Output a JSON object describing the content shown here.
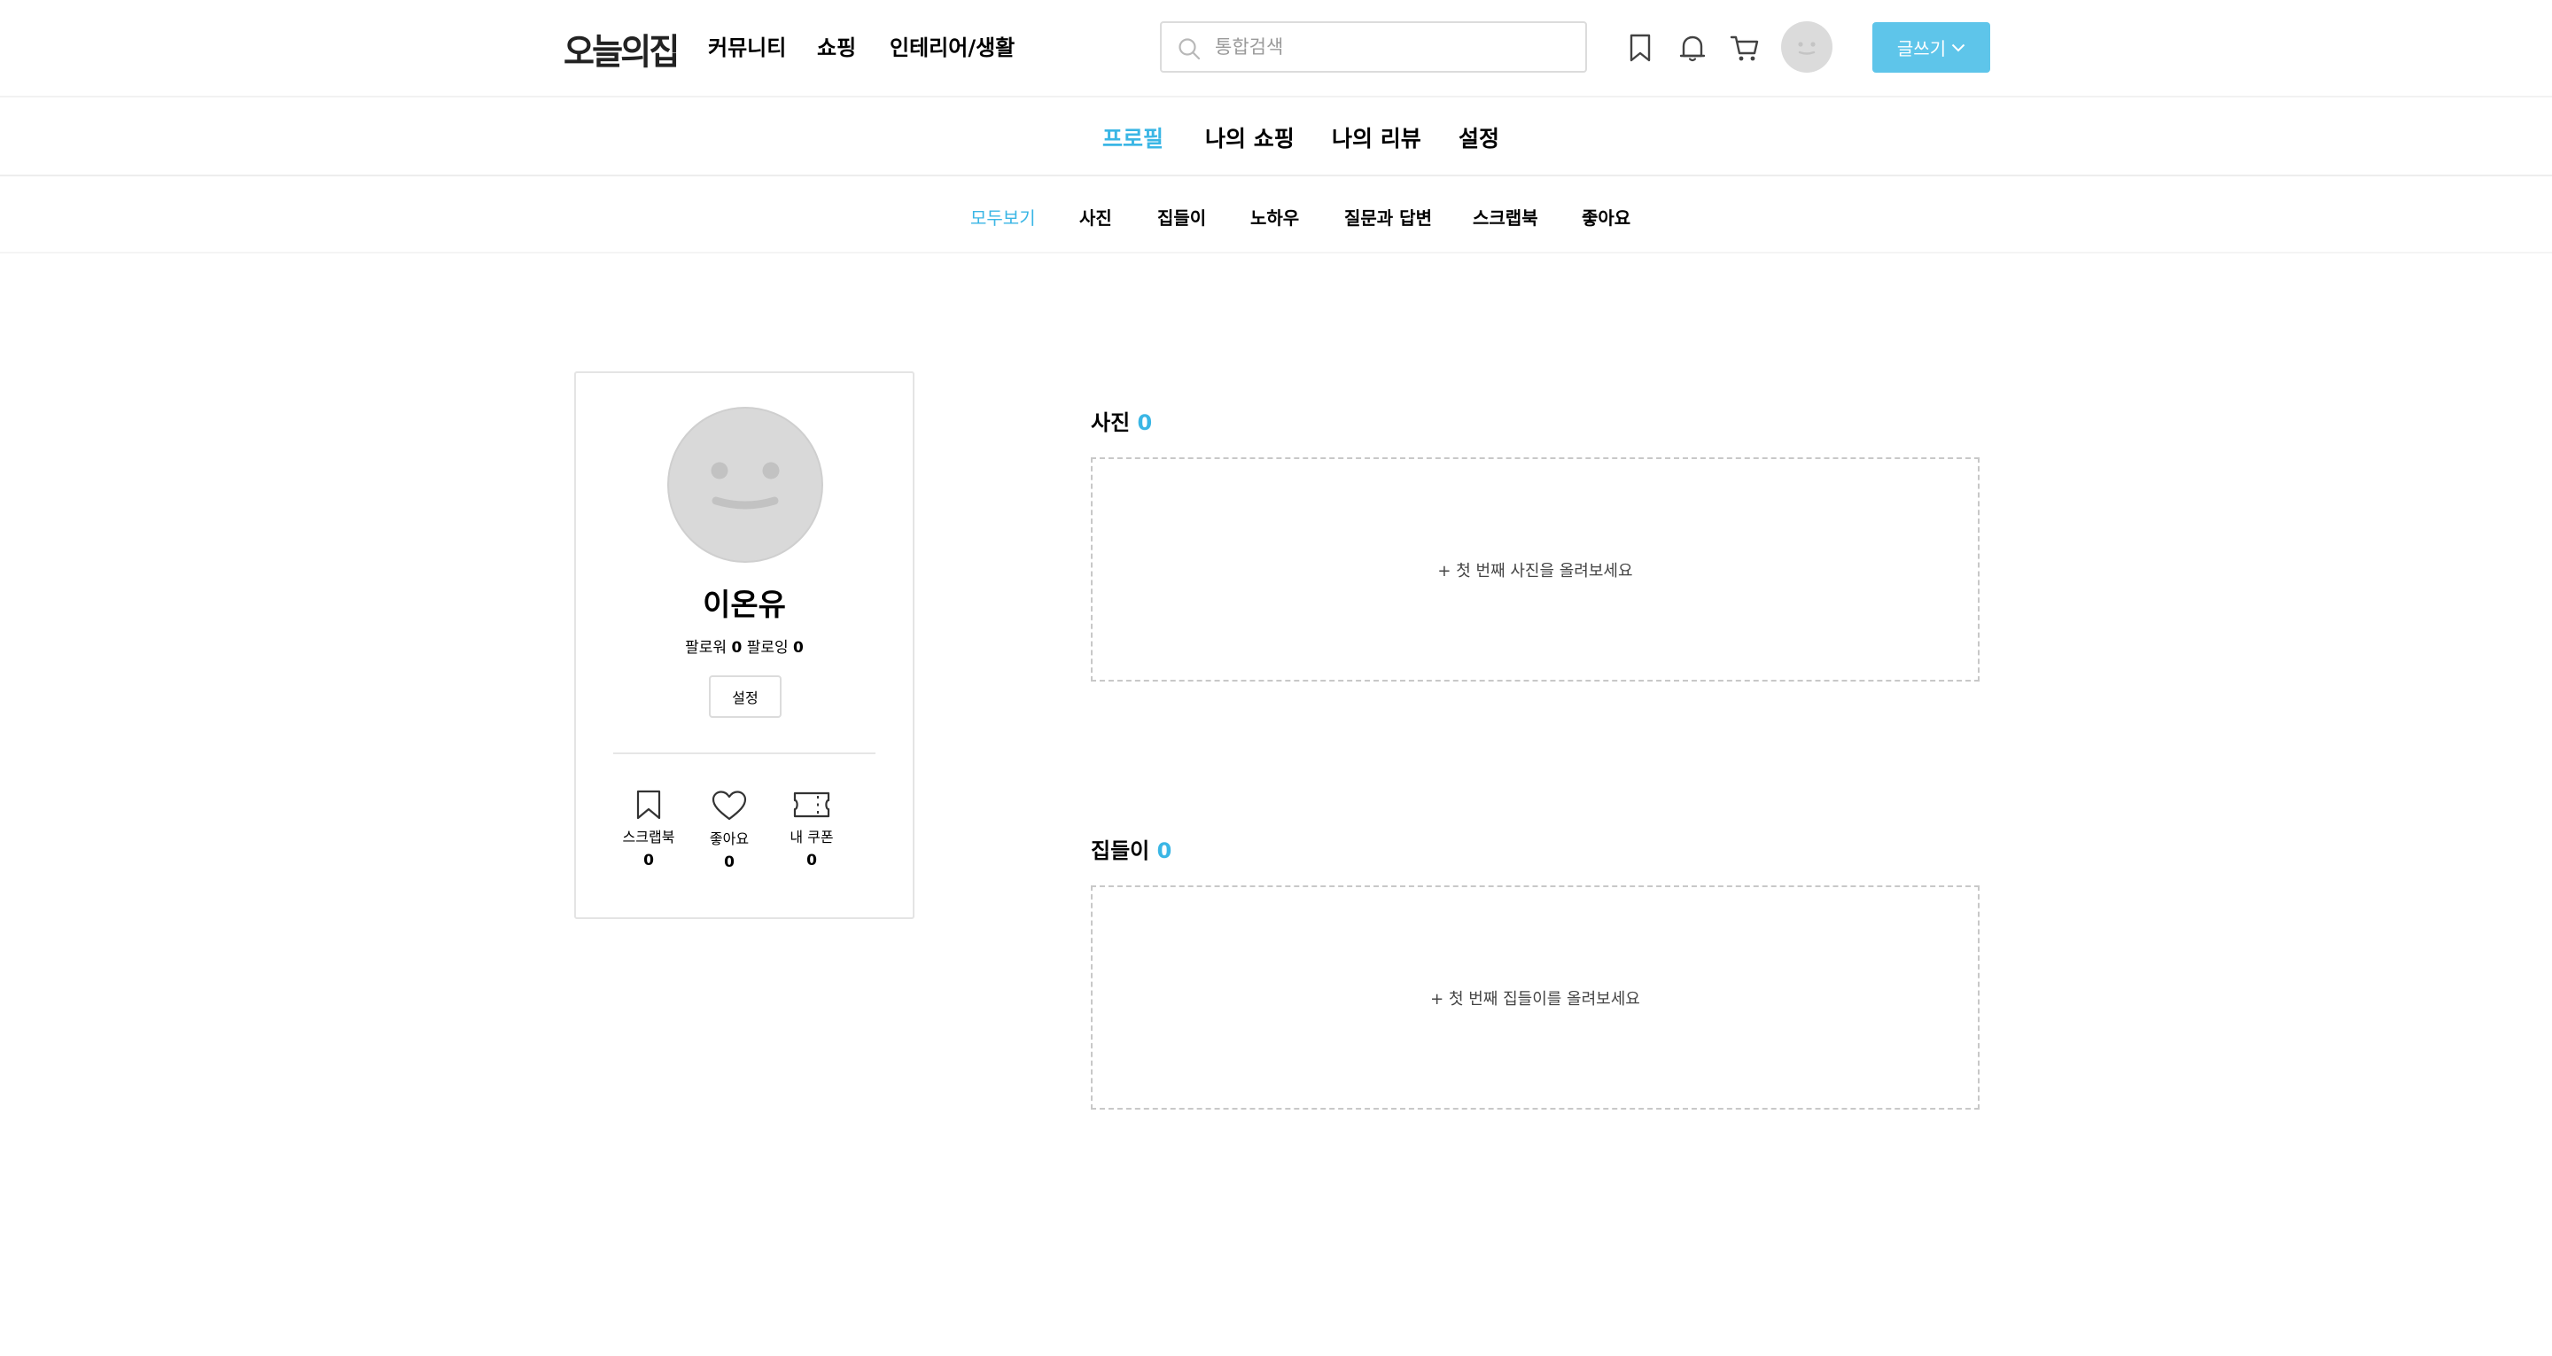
{
  "header": {
    "logo": "오늘의집",
    "nav": [
      "커뮤니티",
      "쇼핑",
      "인테리어/생활"
    ],
    "search_placeholder": "통합검색",
    "write_label": "글쓰기"
  },
  "primary_tabs": [
    "프로필",
    "나의 쇼핑",
    "나의 리뷰",
    "설정"
  ],
  "sub_tabs": [
    "모두보기",
    "사진",
    "집들이",
    "노하우",
    "질문과 답변",
    "스크랩북",
    "좋아요"
  ],
  "profile": {
    "name": "이온유",
    "follower_label": "팔로워",
    "follower_count": "0",
    "following_label": "팔로잉",
    "following_count": "0",
    "settings_label": "설정",
    "stats": [
      {
        "label": "스크랩북",
        "count": "0",
        "icon": "bookmark-icon"
      },
      {
        "label": "좋아요",
        "count": "0",
        "icon": "heart-icon"
      },
      {
        "label": "내 쿠폰",
        "count": "0",
        "icon": "coupon-icon"
      }
    ]
  },
  "sections": [
    {
      "title": "사진",
      "count": "0",
      "empty_text": "+ 첫 번째 사진을 올려보세요"
    },
    {
      "title": "집들이",
      "count": "0",
      "empty_text": "+ 첫 번째 집들이를 올려보세요"
    }
  ],
  "colors": {
    "accent": "#3ab6e5",
    "button": "#5ec5ea",
    "avatar": "#d9d9d9"
  }
}
